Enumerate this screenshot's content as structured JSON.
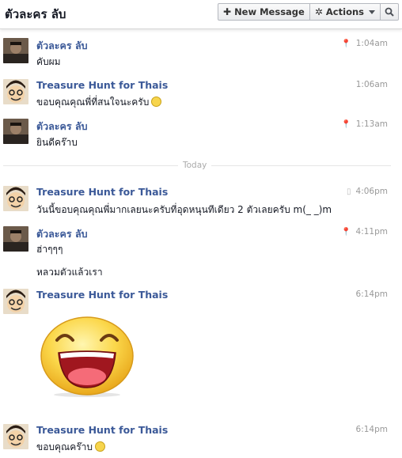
{
  "header": {
    "title": "ตัวละคร ลับ",
    "new_message_label": "New Message",
    "actions_label": "Actions"
  },
  "divider_label": "Today",
  "messages": [
    {
      "sender": "ตัวละคร ลับ",
      "time": "1:04am",
      "time_icon": "location-pin-icon",
      "lines": [
        "คับผม"
      ]
    },
    {
      "sender": "Treasure Hunt for Thais",
      "time": "1:06am",
      "lines": [
        "ขอบคุณคุณพี่ที่สนใจนะครับ"
      ],
      "emoticon": "smile"
    },
    {
      "sender": "ตัวละคร ลับ",
      "time": "1:13am",
      "time_icon": "location-pin-icon",
      "lines": [
        "ยินดีคร๊าบ"
      ]
    },
    {
      "sender": "Treasure Hunt for Thais",
      "time": "4:06pm",
      "time_icon": "mobile-phone-icon",
      "lines": [
        "วันนี้ขอบคุณคุณพี่มากเลยนะครับที่อุดหนุนทีเดียว 2 ตัวเลยครับ m(_ _)m"
      ]
    },
    {
      "sender": "ตัวละคร ลับ",
      "time": "4:11pm",
      "time_icon": "location-pin-icon",
      "lines": [
        "ฮ่าๆๆๆ",
        "หลวมตัวแล้วเรา"
      ]
    },
    {
      "sender": "Treasure Hunt for Thais",
      "time": "6:14pm",
      "attachment": "big-laughing-smiley-sticker"
    },
    {
      "sender": "Treasure Hunt for Thais",
      "time": "6:14pm",
      "lines": [
        "ขอบคุณคร๊าบ"
      ],
      "emoticon": "smile"
    }
  ],
  "colors": {
    "sender_link": "#3b5998",
    "timestamp": "#999999",
    "divider": "#e5e5e5"
  }
}
